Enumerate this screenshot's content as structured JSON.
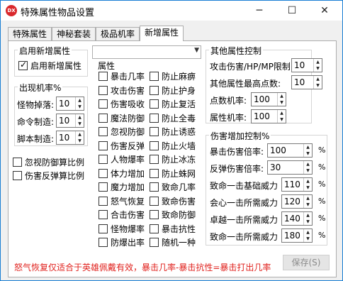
{
  "window": {
    "title": "特殊属性物品设置",
    "icon_text": "DX"
  },
  "tabs": [
    "特殊属性",
    "神秘套装",
    "极品机率",
    "新增属性"
  ],
  "enable_group": {
    "legend": "启用新增属性",
    "checkbox_label": "启用新增属性",
    "checked": true
  },
  "rate_group": {
    "legend": "出现机率%",
    "rows": [
      {
        "label": "怪物掉落:",
        "value": "10"
      },
      {
        "label": "命令制造:",
        "value": "10"
      },
      {
        "label": "脚本制造:",
        "value": "10"
      }
    ]
  },
  "left_checks": [
    {
      "label": "忽视防御算比例",
      "checked": false
    },
    {
      "label": "伤害反弹算比例",
      "checked": false
    }
  ],
  "attr_combo": {
    "value": ""
  },
  "attr_list": {
    "header": "属性",
    "col1": [
      "暴击几率",
      "攻击伤害",
      "伤害吸收",
      "魔法防御",
      "忽视防御",
      "伤害反弹",
      "人物爆率",
      "体力增加",
      "魔力增加",
      "怒气恢复",
      "合击伤害",
      "怪物爆率",
      "防爆出率"
    ],
    "col2": [
      "防止麻痹",
      "防止护身",
      "防止复活",
      "防止全毒",
      "防止诱惑",
      "防止火墙",
      "防止冰冻",
      "防止蛛网",
      "致命几率",
      "致命伤害",
      "致命防御",
      "暴击抗性",
      "随机一种"
    ]
  },
  "other_group": {
    "legend": "其他属性控制",
    "rows": [
      {
        "label": "攻击伤害/HP/MP限制:",
        "value": "10"
      },
      {
        "label": "其他属性最高点数:",
        "value": "10"
      },
      {
        "label": "点数机率:",
        "value": "100"
      },
      {
        "label": "属性机率:",
        "value": "100"
      }
    ]
  },
  "damage_group": {
    "legend": "伤害增加控制%",
    "rows": [
      {
        "label": "暴击伤害倍率:",
        "value": "100",
        "unit": "%"
      },
      {
        "label": "反弹伤害倍率:",
        "value": "30",
        "unit": "%"
      },
      {
        "label": "致命一击基础威力",
        "value": "110",
        "unit": "%"
      },
      {
        "label": "会心一击所需威力",
        "value": "120",
        "unit": "%"
      },
      {
        "label": "卓越一击所需威力",
        "value": "140",
        "unit": "%"
      },
      {
        "label": "致命一击所需威力",
        "value": "180",
        "unit": "%"
      }
    ]
  },
  "note": "怒气恢复仅适合于英雄佩戴有效，暴击几率-暴击抗性=暴击打出几率",
  "save_button": "保存(S)",
  "colors": {
    "note": "#e0201c",
    "accent": "#1a7fd4"
  }
}
